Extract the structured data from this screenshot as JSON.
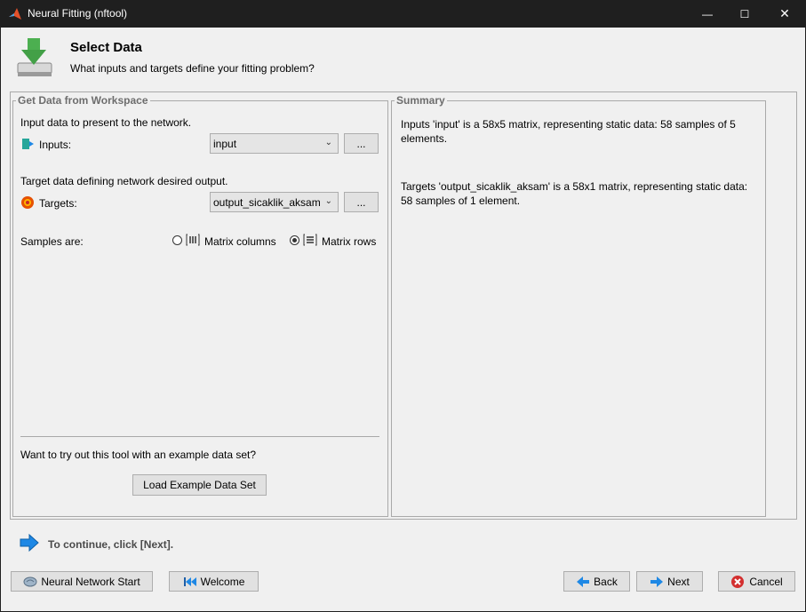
{
  "window": {
    "title": "Neural Fitting (nftool)",
    "controls": {
      "minimize": "—",
      "maximize": "☐",
      "close": "✕"
    }
  },
  "header": {
    "title": "Select Data",
    "subtitle": "What inputs and targets define your fitting problem?"
  },
  "get_data": {
    "legend": "Get Data from Workspace",
    "inputs_desc": "Input data to present to the network.",
    "inputs_label": "Inputs:",
    "inputs_value": "input",
    "targets_desc": "Target data defining network desired output.",
    "targets_label": "Targets:",
    "targets_value": "output_sicaklik_aksam",
    "browse_label": "...",
    "samples_label": "Samples are:",
    "option_columns": "Matrix columns",
    "option_rows": "Matrix rows",
    "selected_option": "Matrix rows",
    "example_prompt": "Want to try out this tool with an example data set?",
    "load_example_button": "Load Example Data Set"
  },
  "summary": {
    "legend": "Summary",
    "inputs_text": "Inputs 'input' is a 58x5 matrix, representing static data: 58 samples of 5 elements.",
    "targets_text": "Targets 'output_sicaklik_aksam' is a 58x1 matrix, representing static data: 58 samples of 1 element."
  },
  "hint": "To continue, click [Next].",
  "footer": {
    "nn_start": "Neural Network Start",
    "welcome": "Welcome",
    "back": "Back",
    "next": "Next",
    "cancel": "Cancel"
  },
  "colors": {
    "titlebar": "#1f1f1f",
    "window_bg": "#f0f0f0",
    "accent_blue": "#1e88e5",
    "cancel_red": "#d32f2f"
  }
}
